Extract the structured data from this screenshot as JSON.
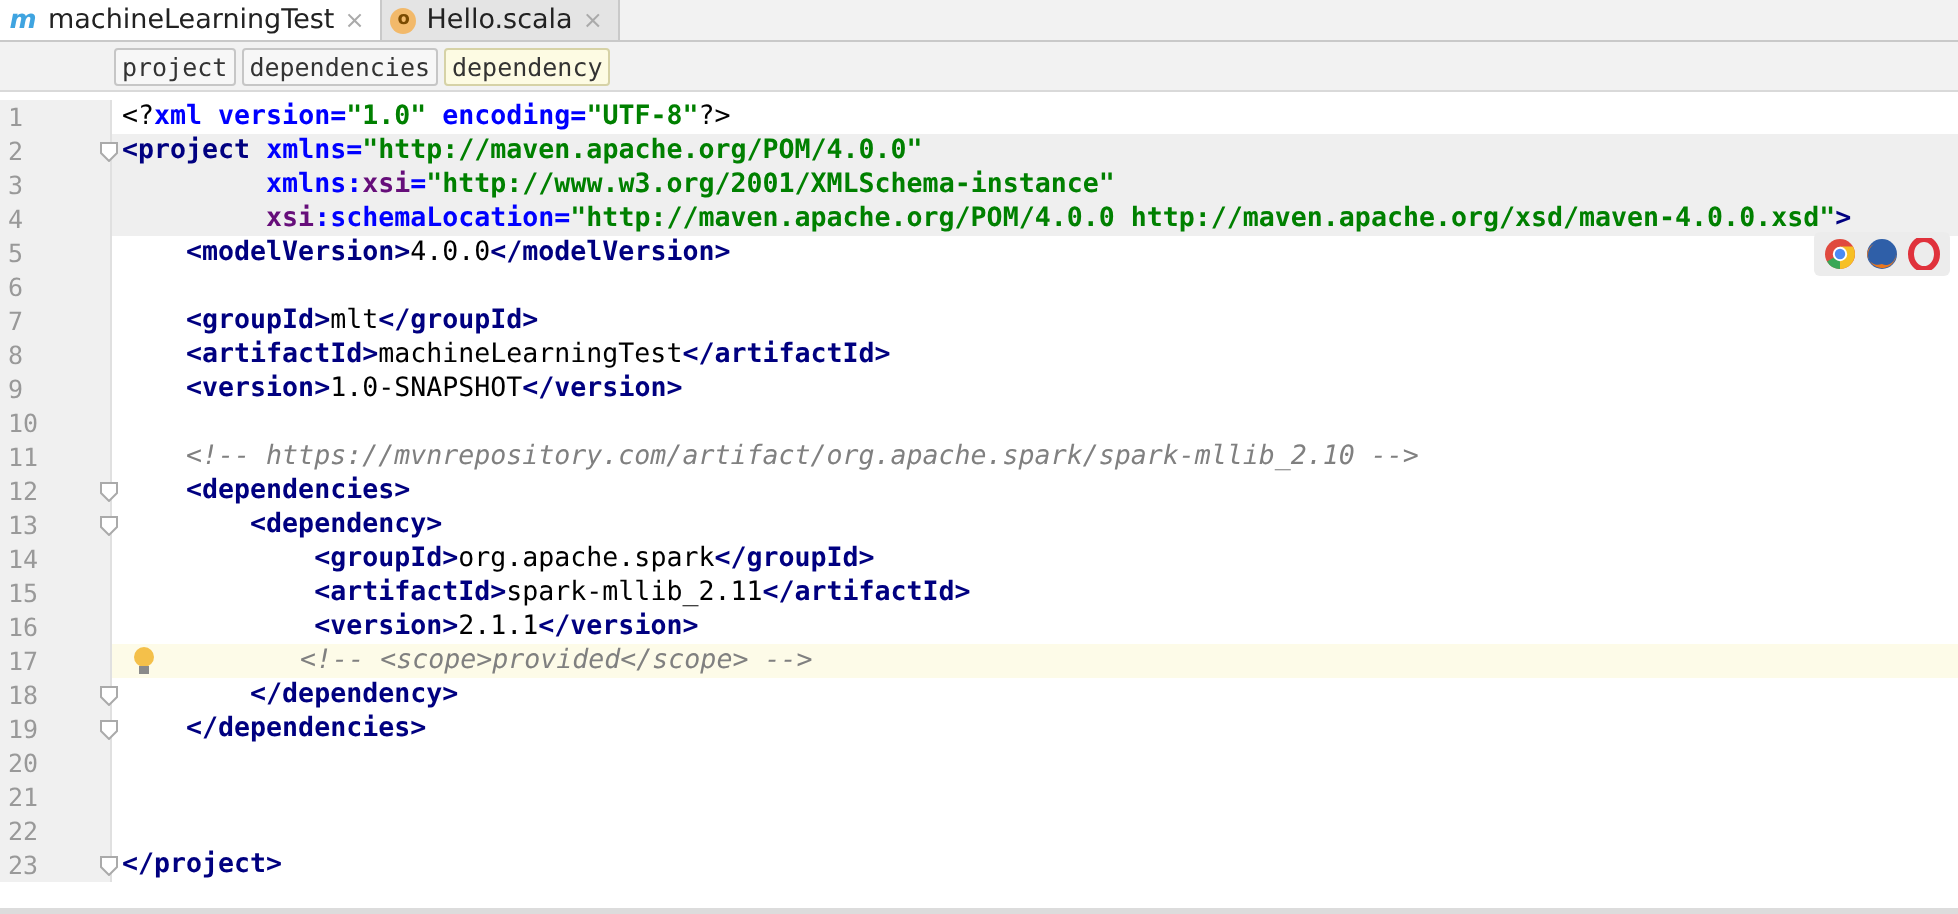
{
  "tabs": [
    {
      "label": "machineLearningTest",
      "icon": "m",
      "close": "×",
      "selected": true
    },
    {
      "label": "Hello.scala",
      "icon": "o",
      "close": "×",
      "selected": false
    }
  ],
  "breadcrumbs": [
    {
      "label": "project",
      "selected": false
    },
    {
      "label": "dependencies",
      "selected": false
    },
    {
      "label": "dependency",
      "selected": true
    }
  ],
  "lines": [
    {
      "number": "1",
      "fold": false,
      "current": false,
      "matched": false,
      "segments": [
        {
          "kind": "text",
          "text": "<?"
        },
        {
          "kind": "attr",
          "text": "xml version="
        },
        {
          "kind": "value",
          "text": "\"1.0\""
        },
        {
          "kind": "attr",
          "text": " encoding="
        },
        {
          "kind": "value",
          "text": "\"UTF-8\""
        },
        {
          "kind": "text",
          "text": "?>"
        }
      ]
    },
    {
      "number": "2",
      "fold": true,
      "current": false,
      "matched": true,
      "segments": [
        {
          "kind": "tag",
          "text": "<project "
        },
        {
          "kind": "attr",
          "text": "xmlns="
        },
        {
          "kind": "value",
          "text": "\"http://maven.apache.org/POM/4.0.0\""
        }
      ]
    },
    {
      "number": "3",
      "fold": false,
      "current": false,
      "matched": true,
      "segments": [
        {
          "kind": "attr",
          "text": "         xmlns:"
        },
        {
          "kind": "ns",
          "text": "xsi"
        },
        {
          "kind": "attr",
          "text": "="
        },
        {
          "kind": "value",
          "text": "\"http://www.w3.org/2001/XMLSchema-instance\""
        }
      ]
    },
    {
      "number": "4",
      "fold": false,
      "current": false,
      "matched": true,
      "segments": [
        {
          "kind": "ns",
          "text": "         xsi"
        },
        {
          "kind": "attr",
          "text": ":schemaLocation="
        },
        {
          "kind": "value",
          "text": "\"http://maven.apache.org/POM/4.0.0 http://maven.apache.org/xsd/maven-4.0.0.xsd\""
        },
        {
          "kind": "tag",
          "text": ">"
        }
      ]
    },
    {
      "number": "5",
      "fold": false,
      "current": false,
      "matched": false,
      "segments": [
        {
          "kind": "tag",
          "text": "    <modelVersion>"
        },
        {
          "kind": "text",
          "text": "4.0.0"
        },
        {
          "kind": "tag",
          "text": "</modelVersion>"
        }
      ]
    },
    {
      "number": "6",
      "fold": false,
      "current": false,
      "matched": false
    },
    {
      "number": "7",
      "fold": false,
      "current": false,
      "matched": false,
      "segments": [
        {
          "kind": "tag",
          "text": "    <groupId>"
        },
        {
          "kind": "text",
          "text": "mlt"
        },
        {
          "kind": "tag",
          "text": "</groupId>"
        }
      ]
    },
    {
      "number": "8",
      "fold": false,
      "current": false,
      "matched": false,
      "segments": [
        {
          "kind": "tag",
          "text": "    <artifactId>"
        },
        {
          "kind": "text",
          "text": "machineLearningTest"
        },
        {
          "kind": "tag",
          "text": "</artifactId>"
        }
      ]
    },
    {
      "number": "9",
      "fold": false,
      "current": false,
      "matched": false,
      "segments": [
        {
          "kind": "tag",
          "text": "    <version>"
        },
        {
          "kind": "text",
          "text": "1.0-SNAPSHOT"
        },
        {
          "kind": "tag",
          "text": "</version>"
        }
      ]
    },
    {
      "number": "10",
      "fold": false,
      "current": false,
      "matched": false
    },
    {
      "number": "11",
      "fold": false,
      "current": false,
      "matched": false,
      "segments": [
        {
          "kind": "comment",
          "text": "    <!-- https://mvnrepository.com/artifact/org.apache.spark/spark-mllib_2.10 -->"
        }
      ]
    },
    {
      "number": "12",
      "fold": true,
      "current": false,
      "matched": false,
      "segments": [
        {
          "kind": "tag",
          "text": "    <dependencies>"
        }
      ]
    },
    {
      "number": "13",
      "fold": true,
      "current": false,
      "matched": false,
      "segments": [
        {
          "kind": "tag",
          "text": "        <dependency>"
        }
      ]
    },
    {
      "number": "14",
      "fold": false,
      "current": false,
      "matched": false,
      "segments": [
        {
          "kind": "tag",
          "text": "            <groupId>"
        },
        {
          "kind": "text",
          "text": "org.apache.spark"
        },
        {
          "kind": "tag",
          "text": "</groupId>"
        }
      ]
    },
    {
      "number": "15",
      "fold": false,
      "current": false,
      "matched": false,
      "segments": [
        {
          "kind": "tag",
          "text": "            <artifactId>"
        },
        {
          "kind": "text",
          "text": "spark-mllib_2.11"
        },
        {
          "kind": "tag",
          "text": "</artifactId>"
        }
      ]
    },
    {
      "number": "16",
      "fold": false,
      "current": false,
      "matched": false,
      "segments": [
        {
          "kind": "tag",
          "text": "            <version>"
        },
        {
          "kind": "text",
          "text": "2.1.1"
        },
        {
          "kind": "tag",
          "text": "</version>"
        }
      ]
    },
    {
      "number": "17",
      "fold": false,
      "current": true,
      "matched": false,
      "bulb": true,
      "segments": [
        {
          "kind": "comment",
          "text": "         <!-- <scope>provided</scope> -->"
        }
      ]
    },
    {
      "number": "18",
      "fold": true,
      "current": false,
      "matched": false,
      "segments": [
        {
          "kind": "tag",
          "text": "        </dependency>"
        }
      ]
    },
    {
      "number": "19",
      "fold": true,
      "current": false,
      "matched": false,
      "segments": [
        {
          "kind": "tag",
          "text": "    </dependencies>"
        }
      ]
    },
    {
      "number": "20",
      "fold": false,
      "current": false,
      "matched": false
    },
    {
      "number": "21",
      "fold": false,
      "current": false,
      "matched": false
    },
    {
      "number": "22",
      "fold": false,
      "current": false,
      "matched": false
    },
    {
      "number": "23",
      "fold": true,
      "current": false,
      "matched": false,
      "segments": [
        {
          "kind": "tag",
          "text": "</project>"
        }
      ]
    }
  ]
}
